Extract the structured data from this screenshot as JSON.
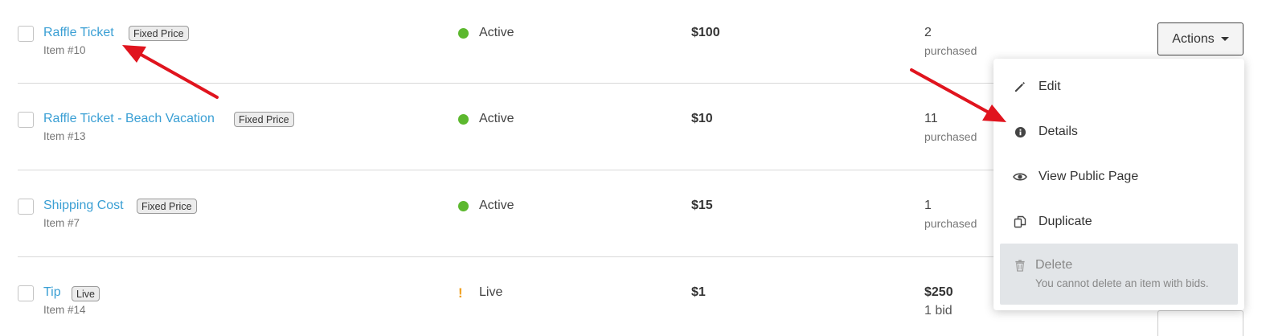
{
  "rows": [
    {
      "name": "Raffle Ticket",
      "badge": "Fixed Price",
      "item_number": "Item #10",
      "status": "Active",
      "price": "$100",
      "count": "2",
      "count_sub": "purchased"
    },
    {
      "name": "Raffle Ticket - Beach Vacation",
      "badge": "Fixed Price",
      "item_number": "Item #13",
      "status": "Active",
      "price": "$10",
      "count": "11",
      "count_sub": "purchased"
    },
    {
      "name": "Shipping Cost",
      "badge": "Fixed Price",
      "item_number": "Item #7",
      "status": "Active",
      "price": "$15",
      "count": "1",
      "count_sub": "purchased"
    },
    {
      "name": "Tip",
      "badge": "Live",
      "item_number": "Item #14",
      "status": "Live",
      "price": "$1",
      "count": "$250",
      "count_sub": "1 bid"
    }
  ],
  "actions_button": {
    "label": "Actions"
  },
  "menu": {
    "items": [
      {
        "label": "Edit",
        "icon": "pencil-icon"
      },
      {
        "label": "Details",
        "icon": "info-icon"
      },
      {
        "label": "View Public Page",
        "icon": "eye-icon"
      },
      {
        "label": "Duplicate",
        "icon": "duplicate-icon"
      }
    ],
    "delete": {
      "label": "Delete",
      "icon": "trash-icon",
      "note": "You cannot delete an item with bids."
    }
  },
  "colors": {
    "link": "#3a9fd4",
    "active": "#5cb82e",
    "live": "#f0a020",
    "annotation_arrow": "#e0141e",
    "disabled_bg": "#e2e5e8"
  }
}
